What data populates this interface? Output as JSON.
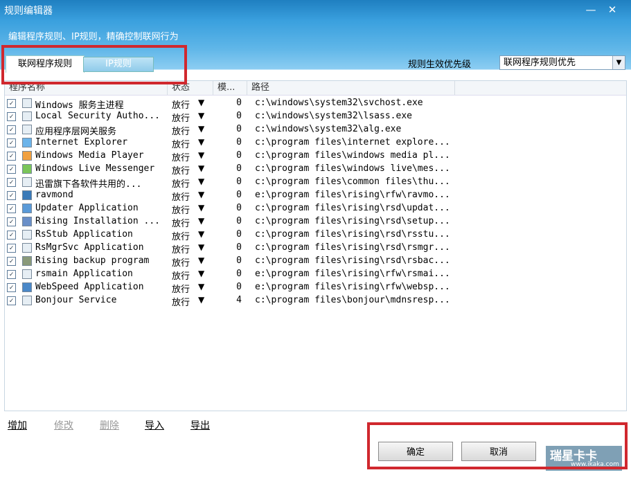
{
  "window": {
    "title": "规则编辑器",
    "subtitle": "编辑程序规则、IP规则，精确控制联网行为"
  },
  "tabs": [
    {
      "label": "联网程序规则",
      "active": true
    },
    {
      "label": "IP规则",
      "active": false
    }
  ],
  "priority": {
    "label": "规则生效优先级",
    "value": "联网程序规则优先"
  },
  "columns": {
    "name": "程序名称",
    "status": "状态",
    "mode": "模...",
    "path": "路径"
  },
  "rows": [
    {
      "name": "Windows 服务主进程",
      "status": "放行",
      "mode": "0",
      "path": "c:\\windows\\system32\\svchost.exe",
      "icon": "window-icon"
    },
    {
      "name": "Local Security Autho...",
      "status": "放行",
      "mode": "0",
      "path": "c:\\windows\\system32\\lsass.exe",
      "icon": "window-icon"
    },
    {
      "name": "应用程序层网关服务",
      "status": "放行",
      "mode": "0",
      "path": "c:\\windows\\system32\\alg.exe",
      "icon": "window-icon"
    },
    {
      "name": "Internet Explorer",
      "status": "放行",
      "mode": "0",
      "path": "c:\\program files\\internet explore...",
      "icon": "ie-icon"
    },
    {
      "name": "Windows Media Player",
      "status": "放行",
      "mode": "0",
      "path": "c:\\program files\\windows media pl...",
      "icon": "media-player-icon"
    },
    {
      "name": "Windows Live Messenger",
      "status": "放行",
      "mode": "0",
      "path": "c:\\program files\\windows live\\mes...",
      "icon": "messenger-icon"
    },
    {
      "name": "迅雷旗下各软件共用的...",
      "status": "放行",
      "mode": "0",
      "path": "c:\\program files\\common files\\thu...",
      "icon": "window-icon"
    },
    {
      "name": "ravmond",
      "status": "放行",
      "mode": "0",
      "path": "e:\\program files\\rising\\rfw\\ravmo...",
      "icon": "globe-icon"
    },
    {
      "name": "Updater Application",
      "status": "放行",
      "mode": "0",
      "path": "c:\\program files\\rising\\rsd\\updat...",
      "icon": "updater-icon"
    },
    {
      "name": "Rising Installation ...",
      "status": "放行",
      "mode": "0",
      "path": "c:\\program files\\rising\\rsd\\setup...",
      "icon": "installer-icon"
    },
    {
      "name": "RsStub Application",
      "status": "放行",
      "mode": "0",
      "path": "c:\\program files\\rising\\rsd\\rsstu...",
      "icon": "window-icon"
    },
    {
      "name": "RsMgrSvc Application",
      "status": "放行",
      "mode": "0",
      "path": "c:\\program files\\rising\\rsd\\rsmgr...",
      "icon": "window-icon"
    },
    {
      "name": "Rising backup program",
      "status": "放行",
      "mode": "0",
      "path": "c:\\program files\\rising\\rsd\\rsbac...",
      "icon": "backup-icon"
    },
    {
      "name": "rsmain Application",
      "status": "放行",
      "mode": "0",
      "path": "e:\\program files\\rising\\rfw\\rsmai...",
      "icon": "window-icon"
    },
    {
      "name": "WebSpeed Application",
      "status": "放行",
      "mode": "0",
      "path": "e:\\program files\\rising\\rfw\\websp...",
      "icon": "webspeed-icon"
    },
    {
      "name": "Bonjour Service",
      "status": "放行",
      "mode": "4",
      "path": "c:\\program files\\bonjour\\mdnsresp...",
      "icon": "window-icon"
    }
  ],
  "actions": {
    "add": "增加",
    "edit": "修改",
    "delete": "删除",
    "import": "导入",
    "export": "导出"
  },
  "buttons": {
    "ok": "确定",
    "cancel": "取消"
  },
  "watermark": {
    "brand": "瑞星卡卡",
    "url": "www.ikaka.com"
  }
}
